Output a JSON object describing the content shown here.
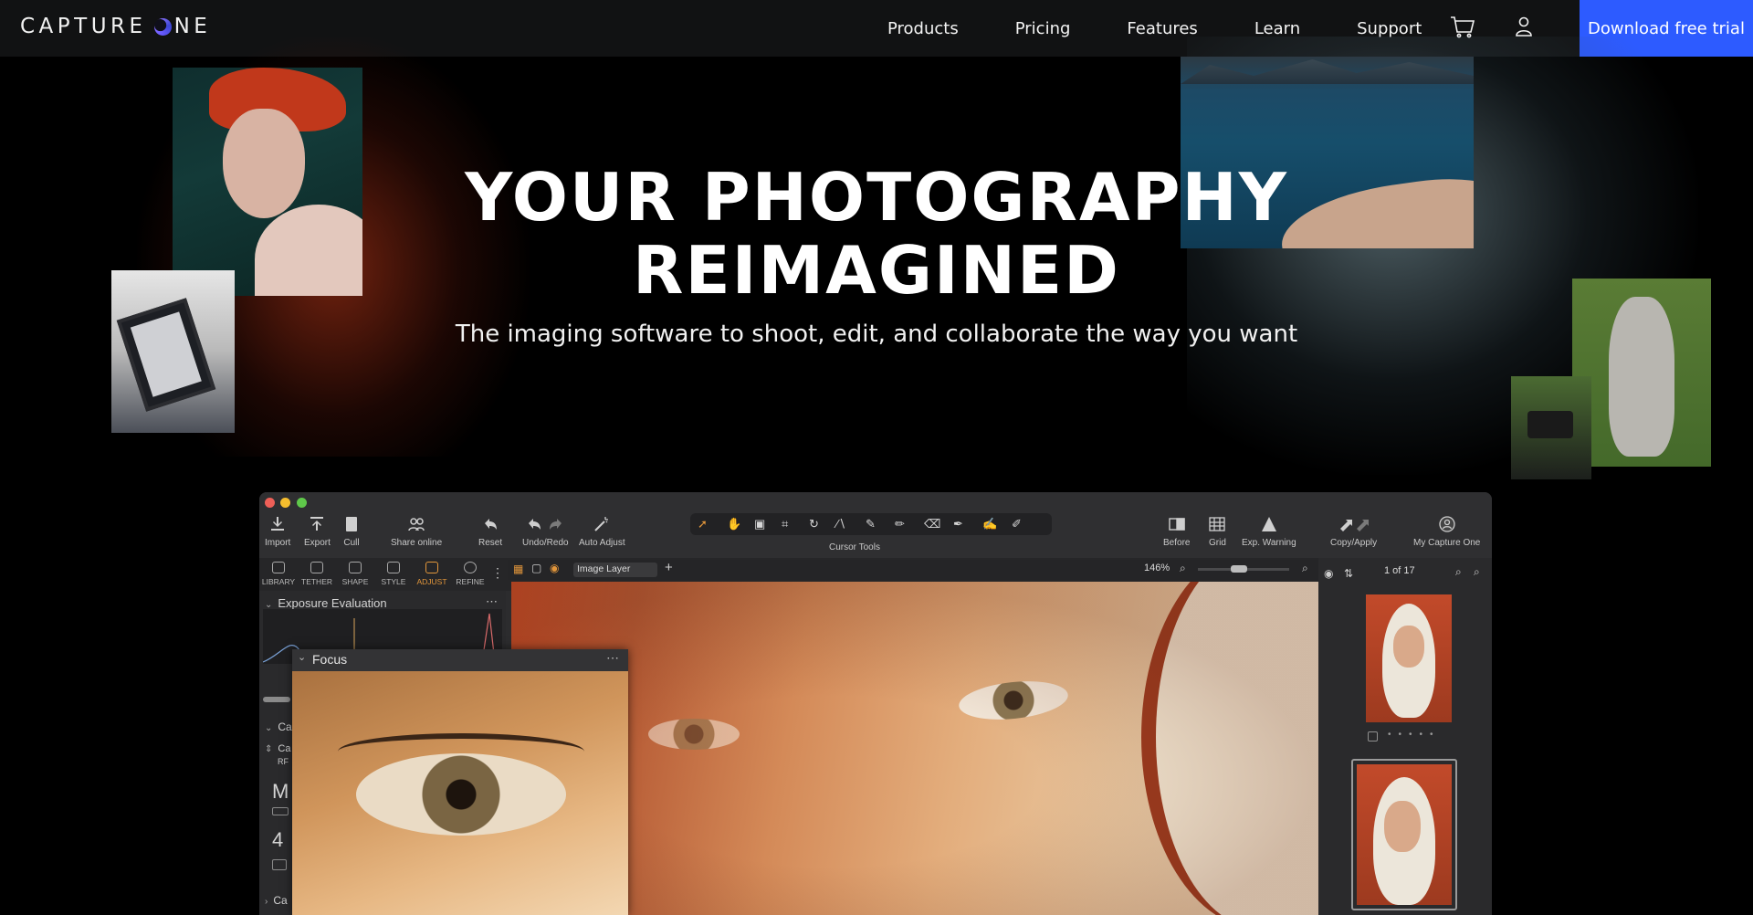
{
  "nav": {
    "logo_left": "CAPTURE",
    "logo_right": "NE",
    "links": [
      "Products",
      "Pricing",
      "Features",
      "Learn",
      "Support"
    ],
    "cart_icon": "cart-icon",
    "user_icon": "user-icon",
    "cta": "Download free trial",
    "cta_color": "#2d5bff"
  },
  "hero": {
    "title_line1": "YOUR PHOTOGRAPHY",
    "title_line2": "REIMAGINED",
    "subtitle": "The imaging software to shoot, edit, and collaborate the way you want"
  },
  "app": {
    "toolbar": {
      "import": "Import",
      "export": "Export",
      "cull": "Cull",
      "share": "Share online",
      "reset": "Reset",
      "undo_redo": "Undo/Redo",
      "auto_adjust": "Auto Adjust",
      "cursor_tools": "Cursor Tools",
      "before": "Before",
      "grid": "Grid",
      "exp_warning": "Exp. Warning",
      "copy_apply": "Copy/Apply",
      "my_capture_one": "My Capture One"
    },
    "tabs": [
      "LIBRARY",
      "TETHER",
      "SHAPE",
      "STYLE",
      "ADJUST",
      "REFINE"
    ],
    "active_tab": "ADJUST",
    "viewer": {
      "layer": "Image Layer",
      "zoom": "146%",
      "counter": "1 of 17"
    },
    "panels": {
      "exposure": "Exposure Evaluation",
      "focus": "Focus",
      "collapsed_1": "Ca",
      "collapsed_2": "Ca",
      "collapsed_3": "Ca",
      "fragment_1": "RF",
      "fragment_m": "M",
      "fragment_num": "4"
    }
  }
}
